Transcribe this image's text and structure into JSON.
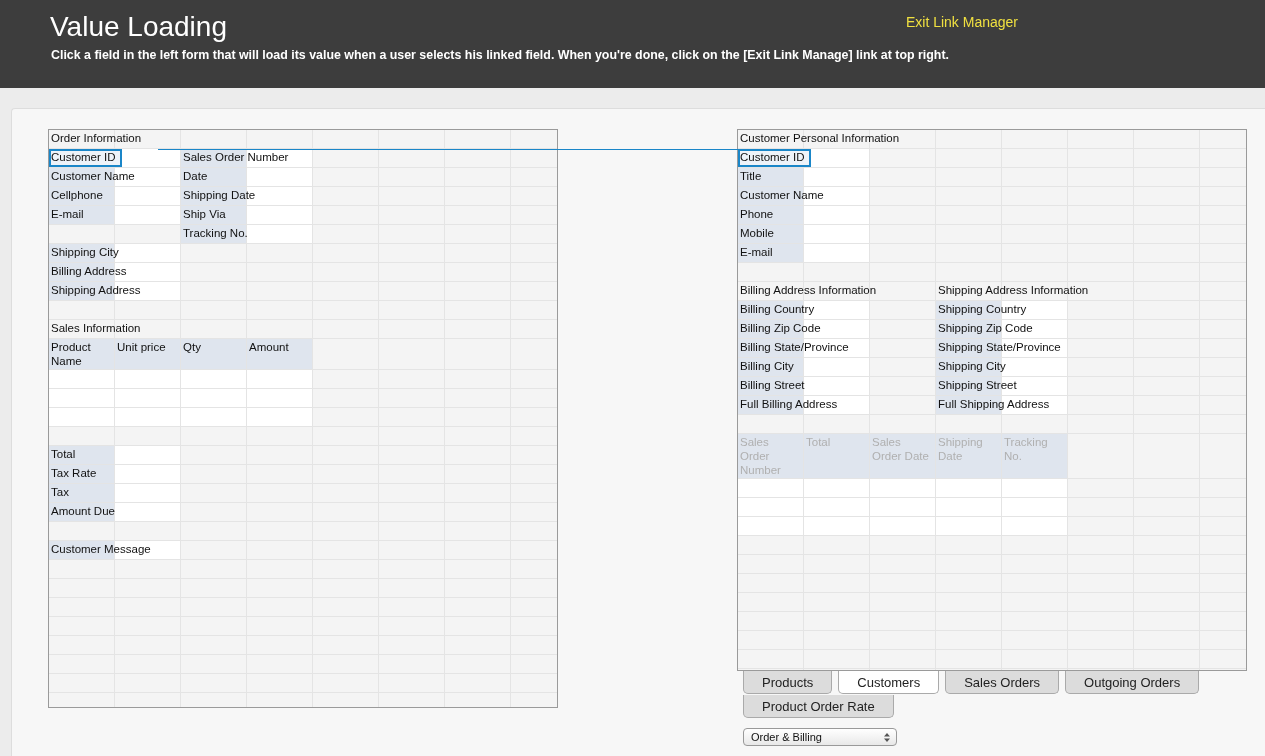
{
  "header": {
    "title": "Value Loading",
    "instructions": "Click a field in the left form that will load its value when a user selects his linked field. When you're done, click on the [Exit Link Manage] link at top right.",
    "exit_link": "Exit Link Manager"
  },
  "left_form": {
    "rows": [
      {
        "cells": [
          {
            "kind": "title",
            "text": "Order Information"
          }
        ]
      },
      {
        "cells": [
          {
            "kind": "label",
            "text": "Customer ID",
            "selected": true
          },
          {
            "kind": "value"
          },
          {
            "kind": "label",
            "text": "Sales Order Number",
            "selected": false
          },
          {
            "kind": "value"
          }
        ]
      },
      {
        "cells": [
          {
            "kind": "label",
            "text": "Customer Name",
            "selected": false
          },
          {
            "kind": "value"
          },
          {
            "kind": "label",
            "text": "Date",
            "selected": false
          },
          {
            "kind": "value"
          }
        ]
      },
      {
        "cells": [
          {
            "kind": "label",
            "text": "Cellphone",
            "selected": false
          },
          {
            "kind": "value"
          },
          {
            "kind": "label",
            "text": "Shipping Date",
            "selected": false
          },
          {
            "kind": "value"
          }
        ]
      },
      {
        "cells": [
          {
            "kind": "label",
            "text": "E-mail",
            "selected": false
          },
          {
            "kind": "value"
          },
          {
            "kind": "label",
            "text": "Ship Via",
            "selected": false
          },
          {
            "kind": "value"
          }
        ]
      },
      {
        "cells": [
          {
            "kind": "blank"
          },
          {
            "kind": "blank"
          },
          {
            "kind": "label",
            "text": "Tracking No.",
            "selected": false
          },
          {
            "kind": "value"
          }
        ]
      },
      {
        "cells": [
          {
            "kind": "label",
            "text": "Shipping City",
            "selected": false
          },
          {
            "kind": "value"
          }
        ]
      },
      {
        "cells": [
          {
            "kind": "label",
            "text": "Billing Address",
            "selected": false
          },
          {
            "kind": "value"
          }
        ]
      },
      {
        "cells": [
          {
            "kind": "label",
            "text": "Shipping Address",
            "selected": false
          },
          {
            "kind": "value"
          }
        ]
      },
      {
        "cells": []
      },
      {
        "cells": [
          {
            "kind": "title",
            "text": "Sales Information"
          }
        ]
      },
      {
        "cells": [
          {
            "kind": "header",
            "text": "Product Name",
            "disabled": false
          },
          {
            "kind": "header",
            "text": "Unit price",
            "disabled": false
          },
          {
            "kind": "header",
            "text": "Qty",
            "disabled": false
          },
          {
            "kind": "header",
            "text": "Amount",
            "disabled": false
          }
        ]
      },
      {
        "cells": [
          {
            "kind": "value"
          },
          {
            "kind": "value"
          },
          {
            "kind": "value"
          },
          {
            "kind": "value"
          }
        ]
      },
      {
        "cells": [
          {
            "kind": "value"
          },
          {
            "kind": "value"
          },
          {
            "kind": "value"
          },
          {
            "kind": "value"
          }
        ]
      },
      {
        "cells": [
          {
            "kind": "value"
          },
          {
            "kind": "value"
          },
          {
            "kind": "value"
          },
          {
            "kind": "value"
          }
        ]
      },
      {
        "cells": []
      },
      {
        "cells": [
          {
            "kind": "label",
            "text": "Total",
            "selected": false
          },
          {
            "kind": "value"
          }
        ]
      },
      {
        "cells": [
          {
            "kind": "label",
            "text": "Tax Rate",
            "selected": false
          },
          {
            "kind": "value"
          }
        ]
      },
      {
        "cells": [
          {
            "kind": "label",
            "text": "Tax",
            "selected": false
          },
          {
            "kind": "value"
          }
        ]
      },
      {
        "cells": [
          {
            "kind": "label",
            "text": "Amount Due",
            "selected": false
          },
          {
            "kind": "value"
          }
        ]
      },
      {
        "cells": []
      },
      {
        "cells": [
          {
            "kind": "label",
            "text": "Customer Message",
            "selected": false
          },
          {
            "kind": "value"
          }
        ]
      }
    ]
  },
  "right_form": {
    "rows": [
      {
        "cells": [
          {
            "kind": "title",
            "text": "Customer Personal Information"
          }
        ]
      },
      {
        "cells": [
          {
            "kind": "label",
            "text": "Customer ID",
            "selected": true
          },
          {
            "kind": "value"
          }
        ]
      },
      {
        "cells": [
          {
            "kind": "label",
            "text": "Title",
            "selected": false
          },
          {
            "kind": "value"
          }
        ]
      },
      {
        "cells": [
          {
            "kind": "label",
            "text": "Customer Name",
            "selected": false
          },
          {
            "kind": "value"
          }
        ]
      },
      {
        "cells": [
          {
            "kind": "label",
            "text": "Phone",
            "selected": false
          },
          {
            "kind": "value"
          }
        ]
      },
      {
        "cells": [
          {
            "kind": "label",
            "text": "Mobile",
            "selected": false
          },
          {
            "kind": "value"
          }
        ]
      },
      {
        "cells": [
          {
            "kind": "label",
            "text": "E-mail",
            "selected": false
          },
          {
            "kind": "value"
          }
        ]
      },
      {
        "cells": []
      },
      {
        "cells": [
          {
            "kind": "title",
            "text": "Billing Address Information"
          },
          {
            "kind": "blank"
          },
          {
            "kind": "blank"
          },
          {
            "kind": "title",
            "text": "Shipping Address Information"
          }
        ]
      },
      {
        "cells": [
          {
            "kind": "label",
            "text": "Billing Country",
            "selected": false
          },
          {
            "kind": "value"
          },
          {
            "kind": "blank"
          },
          {
            "kind": "label",
            "text": "Shipping Country",
            "selected": false
          },
          {
            "kind": "value"
          }
        ]
      },
      {
        "cells": [
          {
            "kind": "label",
            "text": "Billing Zip Code",
            "selected": false
          },
          {
            "kind": "value"
          },
          {
            "kind": "blank"
          },
          {
            "kind": "label",
            "text": "Shipping Zip Code",
            "selected": false
          },
          {
            "kind": "value"
          }
        ]
      },
      {
        "cells": [
          {
            "kind": "label",
            "text": "Billing State/Province",
            "selected": false
          },
          {
            "kind": "value"
          },
          {
            "kind": "blank"
          },
          {
            "kind": "label",
            "text": "Shipping State/Province",
            "selected": false
          },
          {
            "kind": "value"
          }
        ]
      },
      {
        "cells": [
          {
            "kind": "label",
            "text": "Billing City",
            "selected": false
          },
          {
            "kind": "value"
          },
          {
            "kind": "blank"
          },
          {
            "kind": "label",
            "text": "Shipping City",
            "selected": false
          },
          {
            "kind": "value"
          }
        ]
      },
      {
        "cells": [
          {
            "kind": "label",
            "text": "Billing Street",
            "selected": false
          },
          {
            "kind": "value"
          },
          {
            "kind": "blank"
          },
          {
            "kind": "label",
            "text": "Shipping Street",
            "selected": false
          },
          {
            "kind": "value"
          }
        ]
      },
      {
        "cells": [
          {
            "kind": "label",
            "text": "Full Billing Address",
            "selected": false
          },
          {
            "kind": "value"
          },
          {
            "kind": "blank"
          },
          {
            "kind": "label",
            "text": "Full Shipping Address",
            "selected": false
          },
          {
            "kind": "value"
          }
        ]
      },
      {
        "cells": []
      },
      {
        "cells": [
          {
            "kind": "header",
            "text": "Sales Order Number",
            "disabled": true
          },
          {
            "kind": "header",
            "text": "Total",
            "disabled": true
          },
          {
            "kind": "header",
            "text": "Sales Order Date",
            "disabled": true
          },
          {
            "kind": "header",
            "text": "Shipping Date",
            "disabled": true
          },
          {
            "kind": "header",
            "text": "Tracking No.",
            "disabled": true
          }
        ]
      },
      {
        "cells": [
          {
            "kind": "value"
          },
          {
            "kind": "value"
          },
          {
            "kind": "value"
          },
          {
            "kind": "value"
          },
          {
            "kind": "value"
          }
        ]
      },
      {
        "cells": [
          {
            "kind": "value"
          },
          {
            "kind": "value"
          },
          {
            "kind": "value"
          },
          {
            "kind": "value"
          },
          {
            "kind": "value"
          }
        ]
      },
      {
        "cells": [
          {
            "kind": "value"
          },
          {
            "kind": "value"
          },
          {
            "kind": "value"
          },
          {
            "kind": "value"
          },
          {
            "kind": "value"
          }
        ]
      }
    ]
  },
  "tabs": [
    {
      "label": "Products",
      "selected": false
    },
    {
      "label": "Customers",
      "selected": true
    },
    {
      "label": "Sales Orders",
      "selected": false
    },
    {
      "label": "Outgoing Orders",
      "selected": false
    },
    {
      "label": "Product Order Rate",
      "selected": false
    }
  ],
  "view_select": {
    "value": "Order & Billing"
  }
}
